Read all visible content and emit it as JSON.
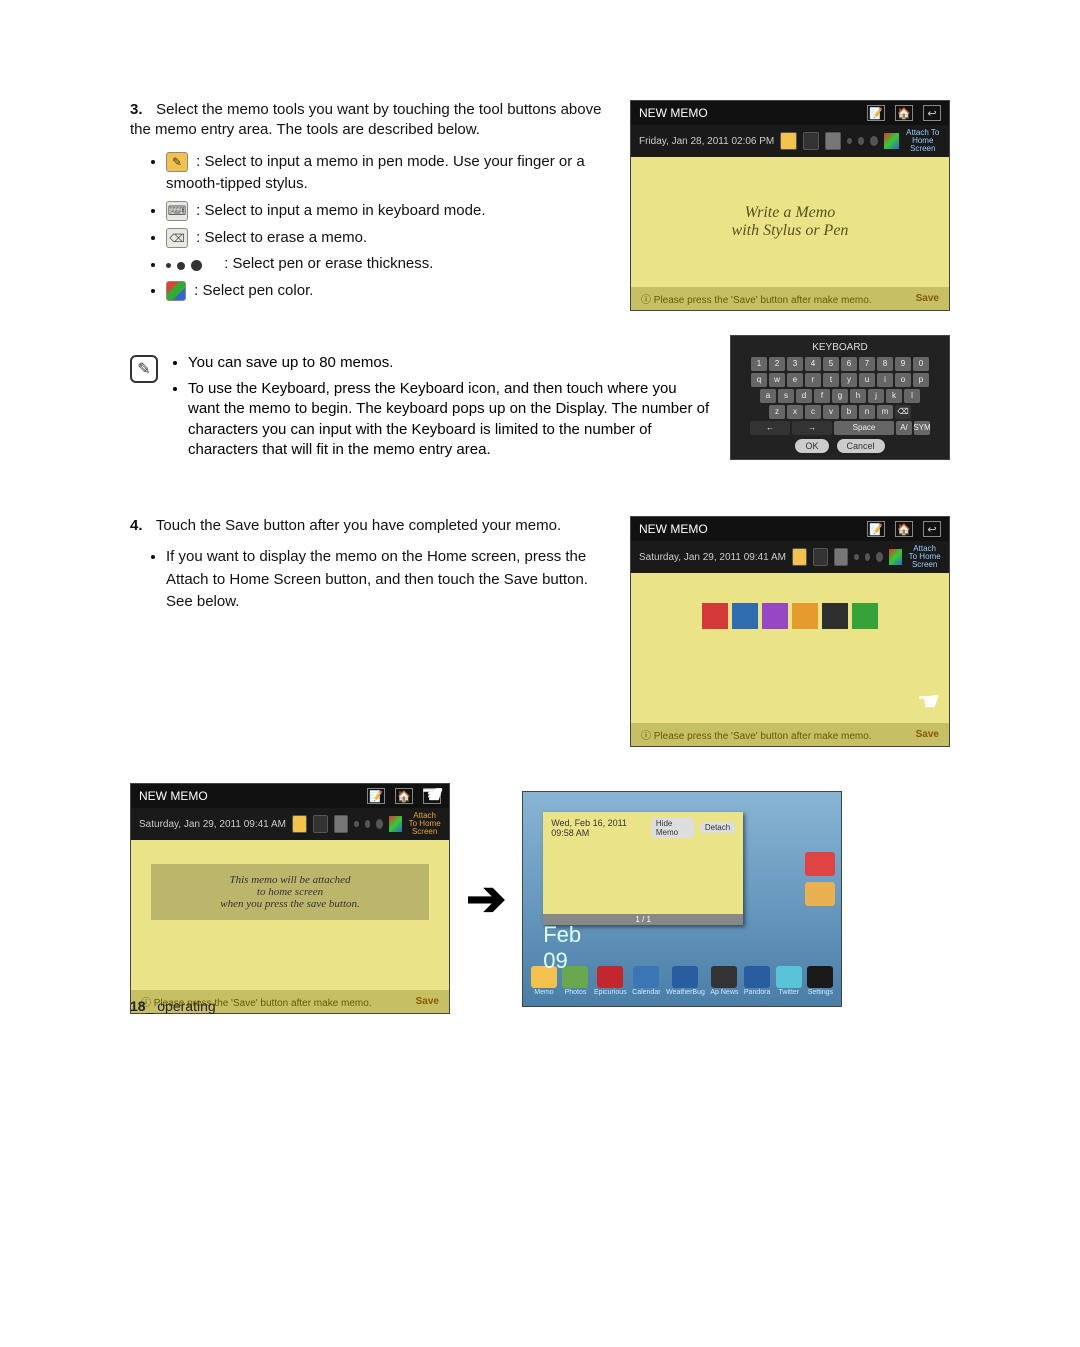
{
  "step3": {
    "num": "3.",
    "text": "Select the memo tools you want by touching the tool buttons above the memo entry area. The tools are described below."
  },
  "tools": {
    "pen": ": Select to input a memo in pen mode. Use your finger or a smooth-tipped stylus.",
    "kbd": ": Select to input a memo in keyboard mode.",
    "eraser": ": Select to erase a memo.",
    "thick": ": Select pen or erase thickness.",
    "color": ": Select pen color."
  },
  "note": {
    "l1": "You can save up to 80 memos.",
    "l2": "To use the Keyboard, press the Keyboard icon, and then touch where you want the memo to begin. The keyboard pops up on the Display. The number of characters you can input with the Keyboard is limited to the number of characters that will fit in the memo entry area."
  },
  "step4": {
    "num": "4.",
    "text": "Touch the Save button after you have completed your memo.",
    "sub": "If you want to display the memo on the Home screen, press the Attach to Home Screen button, and then touch the Save button. See below."
  },
  "shot1": {
    "title": "NEW MEMO",
    "date": "Friday, Jan 28, 2011 02:06 PM",
    "attach": "Attach To Home Screen",
    "body_l1": "Write a Memo",
    "body_l2": "with Stylus or Pen",
    "footer_info": "Please press the 'Save' button after make memo.",
    "footer_save": "Save"
  },
  "shot_kbd": {
    "title": "KEYBOARD",
    "ok": "OK",
    "cancel": "Cancel",
    "space": "Space",
    "sym": "SYM",
    "a": "A/",
    "row0": [
      "1",
      "2",
      "3",
      "4",
      "5",
      "6",
      "7",
      "8",
      "9",
      "0"
    ],
    "row1": [
      "q",
      "w",
      "e",
      "r",
      "t",
      "y",
      "u",
      "i",
      "o",
      "p"
    ],
    "row2": [
      "a",
      "s",
      "d",
      "f",
      "g",
      "h",
      "j",
      "k",
      "l"
    ],
    "row3": [
      "z",
      "x",
      "c",
      "v",
      "b",
      "n",
      "m"
    ]
  },
  "shot2": {
    "title": "NEW MEMO",
    "date": "Saturday, Jan 29, 2011 09:41 AM",
    "attach": "Attach To Home Screen",
    "footer_info": "Please press the 'Save' button after make memo.",
    "footer_save": "Save",
    "colors": [
      "#d43a3a",
      "#2f6db0",
      "#9747c1",
      "#e59b2e",
      "#2f2f2f",
      "#37a23a"
    ]
  },
  "shot3": {
    "title": "NEW MEMO",
    "date": "Saturday, Jan 29, 2011 09:41 AM",
    "attach": "Attach To Home Screen",
    "msg_l1": "This memo will be attached",
    "msg_l2": "to home screen",
    "msg_l3": "when you press the save button.",
    "footer_info": "Please press the 'Save' button after make memo.",
    "footer_save": "Save"
  },
  "shot_home": {
    "date": "Wed, Feb 16, 2011 09:58 AM",
    "hide": "Hide Memo",
    "detach": "Detach",
    "page": "1 / 1",
    "big_l1": "Feb",
    "big_l2": "09",
    "dock": [
      "Memo",
      "Photos",
      "Epicurious",
      "Calendar",
      "WeatherBug",
      "Ap News",
      "Pandora",
      "Twitter",
      "Settings"
    ],
    "dock_colors": [
      "#f2c14e",
      "#6aa84f",
      "#c1272d",
      "#3b77b7",
      "#2a5d9f",
      "#333333",
      "#2a5d9f",
      "#59c4d8",
      "#1a1a1a"
    ]
  },
  "footer": {
    "num": "18",
    "sep": "_",
    "label": " operating"
  },
  "icons": {
    "home": "🏠",
    "back": "↩",
    "memo": "📝",
    "info": "ⓘ"
  }
}
